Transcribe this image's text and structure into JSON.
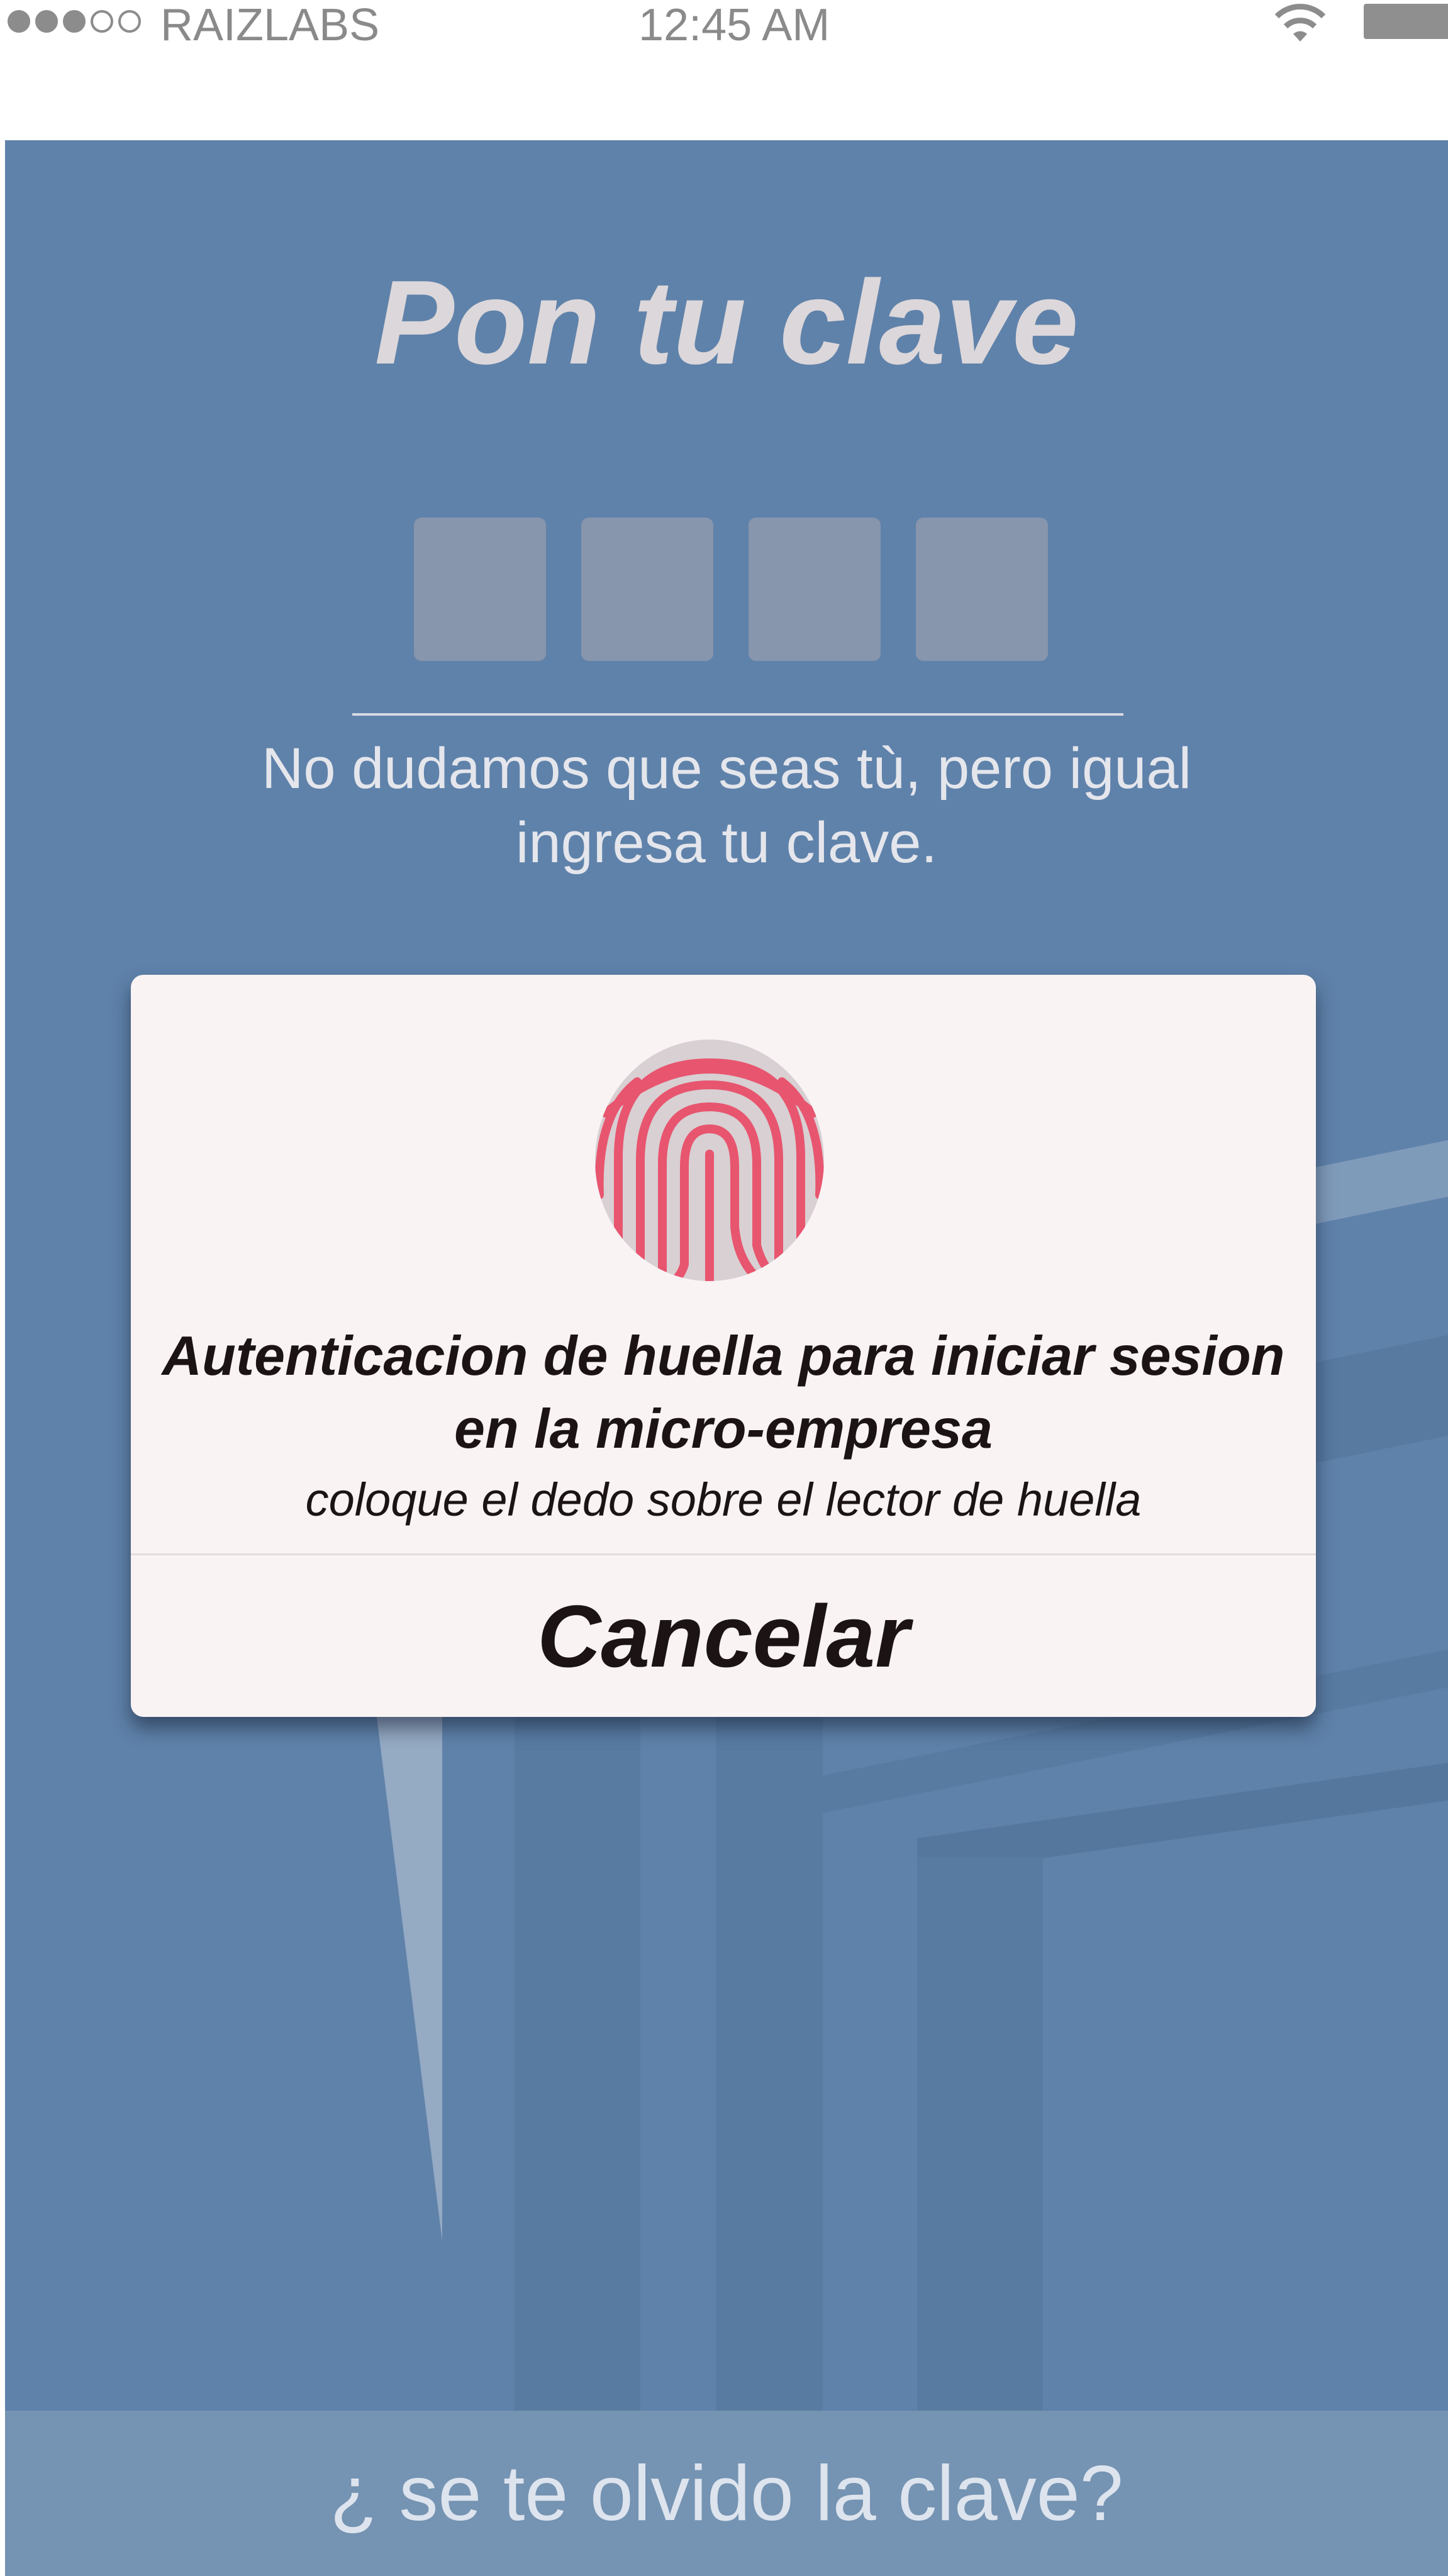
{
  "status_bar": {
    "signal_dots_filled": 3,
    "signal_dots_total": 5,
    "carrier": "RAIZLABS",
    "time": "12:45 AM",
    "wifi_icon": "wifi-icon",
    "battery_icon": "battery-icon"
  },
  "main": {
    "title": "Pon tu clave",
    "pin_length": 4,
    "subtitle": "No dudamos que seas tù, pero igual ingresa tu clave."
  },
  "dialog": {
    "icon": "fingerprint-icon",
    "title": "Autenticacion de huella para iniciar sesion en la micro-empresa",
    "message": "coloque el dedo sobre el lector de huella",
    "cancel_label": "Cancelar"
  },
  "footer": {
    "forgot_label": "¿ se te olvido la clave?"
  },
  "colors": {
    "background_blue": "#5f82aa",
    "dialog_background": "#f9f3f4",
    "fingerprint_pink": "#e8556f",
    "pin_box": "#8795ad"
  }
}
